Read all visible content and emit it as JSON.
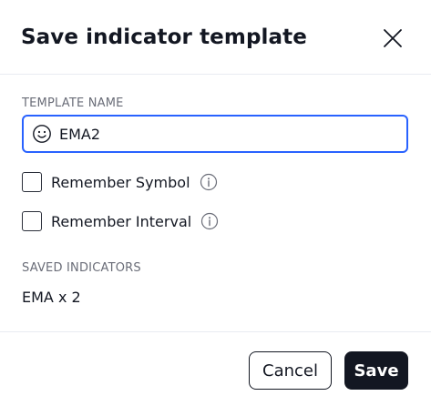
{
  "dialog": {
    "title": "Save indicator template",
    "close_icon": "close-icon"
  },
  "template_name": {
    "label": "TEMPLATE NAME",
    "value": "EMA2",
    "emoji_icon": "smiley-icon"
  },
  "options": [
    {
      "label": "Remember Symbol",
      "checked": false,
      "info_icon": "info-icon"
    },
    {
      "label": "Remember Interval",
      "checked": false,
      "info_icon": "info-icon"
    }
  ],
  "saved_indicators": {
    "label": "SAVED INDICATORS",
    "value": "EMA x 2"
  },
  "footer": {
    "cancel_label": "Cancel",
    "save_label": "Save"
  },
  "colors": {
    "accent": "#2962ff",
    "primary_button": "#131722",
    "text": "#131722",
    "muted_text": "#6a6d78"
  }
}
